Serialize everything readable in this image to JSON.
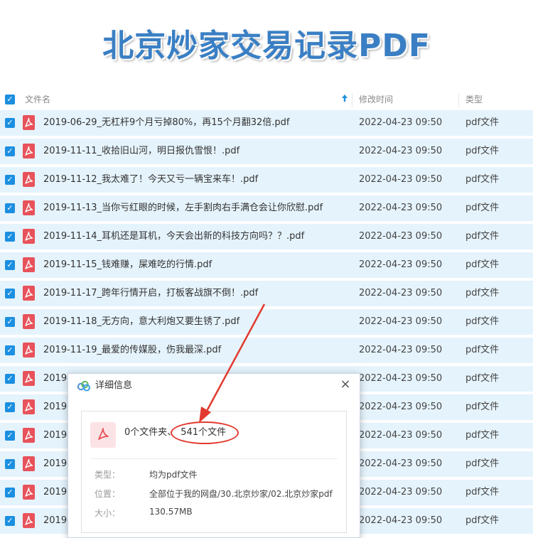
{
  "banner": {
    "title": "北京炒家交易记录PDF"
  },
  "list": {
    "header": {
      "name": "文件名",
      "modified": "修改时间",
      "type": "类型",
      "sort_icon": "arrow-up-icon"
    },
    "rows": [
      {
        "name": "2019-06-29_无杠杆9个月亏掉80%，再15个月翻32倍.pdf",
        "date": "2022-04-23 09:50",
        "type": "pdf文件"
      },
      {
        "name": "2019-11-11_收拾旧山河，明日报仇雪恨！.pdf",
        "date": "2022-04-23 09:50",
        "type": "pdf文件"
      },
      {
        "name": "2019-11-12_我太难了！今天又亏一辆宝来车！.pdf",
        "date": "2022-04-23 09:50",
        "type": "pdf文件"
      },
      {
        "name": "2019-11-13_当你亏红眼的时候，左手割肉右手满仓会让你欣慰.pdf",
        "date": "2022-04-23 09:50",
        "type": "pdf文件"
      },
      {
        "name": "2019-11-14_耳机还是耳机，今天会出新的科技方向吗？？.pdf",
        "date": "2022-04-23 09:50",
        "type": "pdf文件"
      },
      {
        "name": "2019-11-15_钱难赚，屎难吃的行情.pdf",
        "date": "2022-04-23 09:50",
        "type": "pdf文件"
      },
      {
        "name": "2019-11-17_跨年行情开启，打板客战旗不倒！.pdf",
        "date": "2022-04-23 09:50",
        "type": "pdf文件"
      },
      {
        "name": "2019-11-18_无方向，意大利炮又要生锈了.pdf",
        "date": "2022-04-23 09:50",
        "type": "pdf文件"
      },
      {
        "name": "2019-11-19_最爱的传媒股，伤我最深.pdf",
        "date": "2022-04-23 09:50",
        "type": "pdf文件"
      },
      {
        "name": "2019-",
        "date": "2022-04-23 09:50",
        "type": "pdf文件"
      },
      {
        "name": "2019-",
        "date": "2022-04-23 09:50",
        "type": "pdf文件"
      },
      {
        "name": "2019-",
        "date": "2022-04-23 09:50",
        "type": "pdf文件"
      },
      {
        "name": "2019-",
        "date": "2022-04-23 09:50",
        "type": "pdf文件"
      },
      {
        "name": "2019-",
        "date": "2022-04-23 09:50",
        "type": "pdf文件"
      },
      {
        "name": "2019-",
        "date": "2022-04-23 09:50",
        "type": "pdf文件"
      }
    ]
  },
  "dialog": {
    "title": "详细信息",
    "close": "×",
    "folders": "0个文件夹、",
    "files": "541个文件",
    "type_label": "类型：",
    "type_value": "均为pdf文件",
    "location_label": "位置：",
    "location_value": "全部位于我的网盘/30.北京炒家/02.北京炒家pdf",
    "size_label": "大小：",
    "size_value": "130.57MB"
  },
  "colors": {
    "accent": "#1c8fe0",
    "row_bg": "#e5f3fc",
    "pdf_red": "#e8525a",
    "annotation_red": "#e23a2f",
    "title_blue": "#3a7fc4"
  }
}
